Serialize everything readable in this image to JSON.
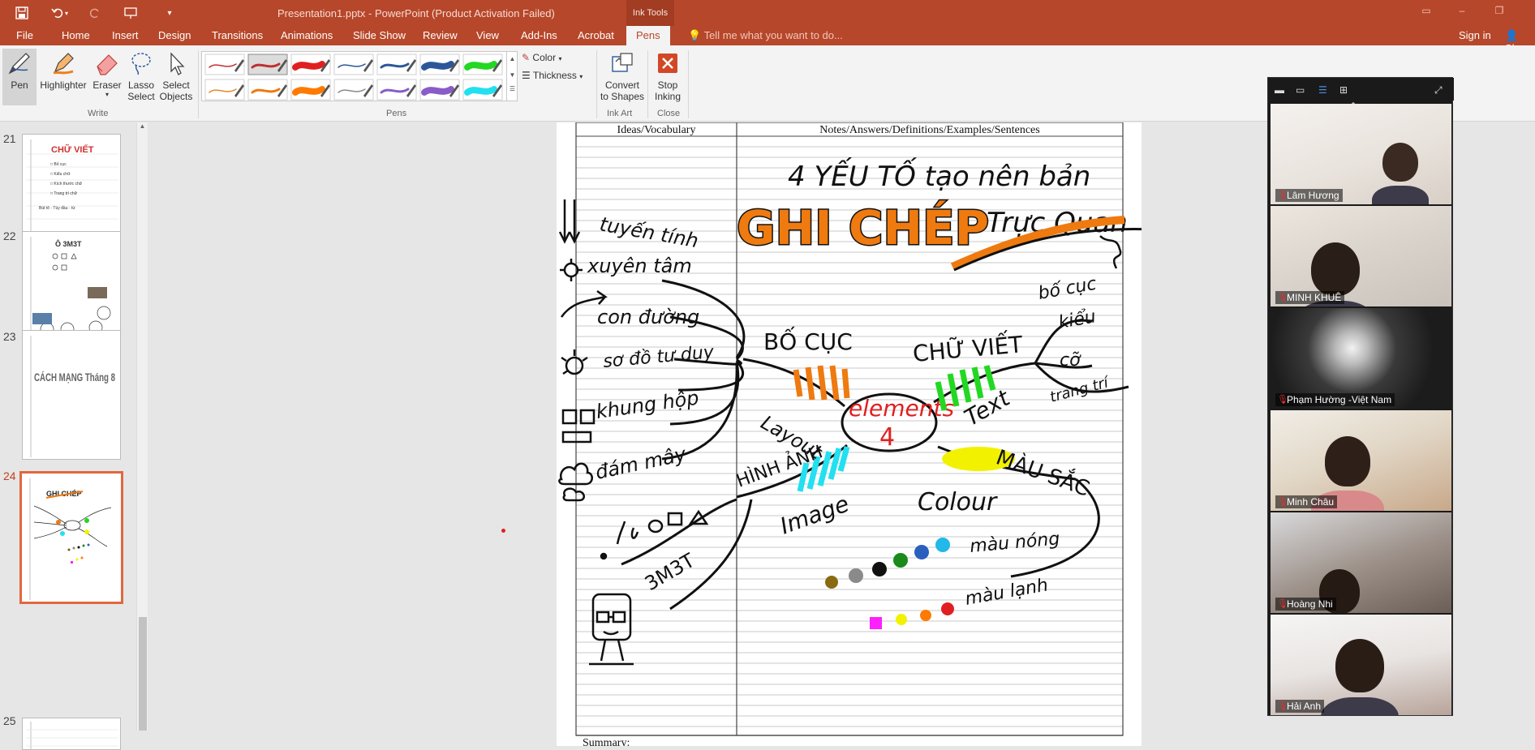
{
  "window": {
    "title": "Presentation1.pptx - PowerPoint (Product Activation Failed)",
    "context_tab": "Ink Tools"
  },
  "menu": {
    "tabs": [
      "File",
      "Home",
      "Insert",
      "Design",
      "Transitions",
      "Animations",
      "Slide Show",
      "Review",
      "View",
      "Add-Ins",
      "Acrobat",
      "Pens"
    ],
    "active_tab": "Pens",
    "tell_me": "Tell me what you want to do...",
    "sign_in": "Sign in",
    "share": "Sha"
  },
  "ribbon": {
    "write": {
      "label": "Write",
      "pen": "Pen",
      "highlighter": "Highlighter",
      "eraser": "Eraser",
      "lasso": "Lasso Select",
      "lasso_line1": "Lasso",
      "lasso_line2": "Select",
      "select_line1": "Select",
      "select_line2": "Objects"
    },
    "pens": {
      "label": "Pens",
      "color": "Color",
      "thickness": "Thickness",
      "row1_colors": [
        "#c03030",
        "#c03030",
        "#e02020",
        "#2b579a",
        "#2b579a",
        "#2b579a",
        "#22d822"
      ],
      "row2_colors": [
        "#e8892b",
        "#ee7a10",
        "#ff7a00",
        "#8a8a8a",
        "#8a5cc8",
        "#8a5cc8",
        "#22e0f0"
      ]
    },
    "ink_art": {
      "label": "Ink Art",
      "convert_line1": "Convert",
      "convert_line2": "to Shapes"
    },
    "close": {
      "label": "Close",
      "stop_line1": "Stop",
      "stop_line2": "Inking"
    }
  },
  "thumbnails": {
    "slides": [
      {
        "number": "21",
        "heading": "CHỮ VIẾT"
      },
      {
        "number": "22",
        "heading": "Ô 3M3T"
      },
      {
        "number": "23",
        "heading": "CÁCH MẠNG Tháng 8"
      },
      {
        "number": "24",
        "heading": "GHI CHÉP"
      },
      {
        "number": "25",
        "heading": ""
      }
    ],
    "active": "24"
  },
  "slide": {
    "header_left": "Ideas/Vocabulary",
    "header_right": "Notes/Answers/Definitions/Examples/Sentences",
    "summary": "Summary:",
    "ink_text": {
      "top": "4 YẾU TỐ tạo nên bản",
      "main_title": "GHI CHÉP",
      "subtitle": "Trực Quan",
      "center_1": "elements",
      "center_2": "4",
      "bo_cuc": "BỐ CỤC",
      "layout": "Layout",
      "chu_viet": "CHỮ VIẾT",
      "text": "Text",
      "hinh_anh": "HÌNH ẢNH",
      "image": "Image",
      "mau_sac": "MÀU SẮC",
      "colour": "Colour",
      "mau_nong": "màu nóng",
      "mau_lanh": "màu lạnh",
      "bo_cuc_r": "bố cục",
      "kieu": "kiểu",
      "co": "cỡ",
      "trang_tri": "trang trí",
      "left_items": [
        "tuyến tính",
        "xuyên tâm",
        "con đường",
        "sơ đồ tư duy",
        "khung hộp",
        "đám mây"
      ],
      "m3t": "3M3T"
    }
  },
  "zoom": {
    "participants": [
      "Lâm Hương",
      "MINH KHUÊ",
      "Phạm Hường -Việt Nam",
      "Minh Châu",
      "Hoàng Nhi",
      "Hải Anh"
    ]
  }
}
